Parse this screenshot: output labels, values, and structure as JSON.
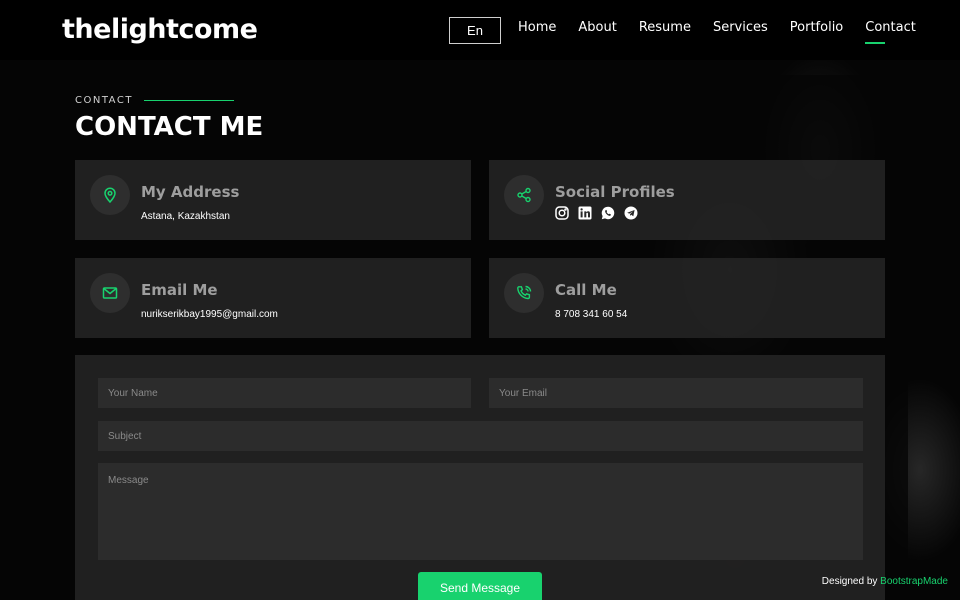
{
  "brand": {
    "logo": "thelightcome",
    "accent": "#18d26e"
  },
  "header": {
    "lang": "En",
    "nav": [
      {
        "label": "Home"
      },
      {
        "label": "About"
      },
      {
        "label": "Resume"
      },
      {
        "label": "Services"
      },
      {
        "label": "Portfolio"
      },
      {
        "label": "Contact",
        "active": true
      }
    ]
  },
  "section": {
    "label": "CONTACT",
    "title": "CONTACT ME"
  },
  "info": {
    "address": {
      "title": "My Address",
      "text": "Astana, Kazakhstan",
      "icon": "map-pin-icon"
    },
    "social": {
      "title": "Social Profiles",
      "icon": "share-icon",
      "profiles": [
        "instagram-icon",
        "linkedin-icon",
        "whatsapp-icon",
        "telegram-icon"
      ]
    },
    "email": {
      "title": "Email Me",
      "text": "nurikserikbay1995@gmail.com",
      "icon": "envelope-icon"
    },
    "phone": {
      "title": "Call Me",
      "text": "8 708 341 60 54",
      "icon": "phone-call-icon"
    }
  },
  "form": {
    "name_placeholder": "Your Name",
    "email_placeholder": "Your Email",
    "subject_placeholder": "Subject",
    "message_placeholder": "Message",
    "submit_label": "Send Message"
  },
  "credits": {
    "prefix": "Designed by",
    "link": "BootstrapMade"
  }
}
